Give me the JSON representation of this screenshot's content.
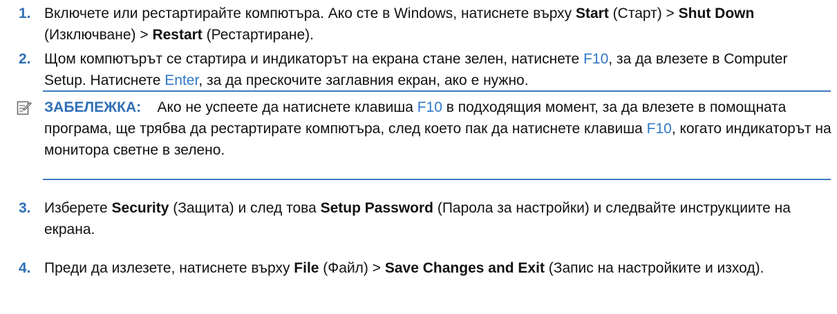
{
  "steps": [
    {
      "number": "1.",
      "parts": [
        "Включете или рестартирайте компютъра. Ако сте в Windows, натиснете върху ",
        "Start",
        " (Старт) > ",
        "Shut Down",
        " (Изключване) > ",
        "Restart",
        " (Рестартиране)."
      ]
    },
    {
      "number": "2.",
      "parts": [
        "Щом компютърът се стартира и индикаторът на екрана стане зелен, натиснете ",
        "F10",
        ", за да влезете в Computer Setup. Натиснете ",
        "Enter",
        ", за да прескочите заглавния екран, ако е нужно."
      ]
    },
    {
      "number": "3.",
      "parts": [
        "Изберете ",
        "Security",
        " (Защита) и след това ",
        "Setup Password",
        " (Парола за настройки) и следвайте инструкциите на екрана."
      ]
    },
    {
      "number": "4.",
      "parts": [
        "Преди да излезете, натиснете върху ",
        "File",
        " (Файл) > ",
        "Save Changes and Exit",
        " (Запис на настройките и изход)."
      ]
    }
  ],
  "note": {
    "icon": "note-pencil-icon",
    "label": "ЗАБЕЛЕЖКА:",
    "parts": [
      "Ако не успеете да натиснете клавиша ",
      "F10",
      " в подходящия момент, за да влезете в помощната програма, ще трябва да рестартирате компютъра, след което пак да натиснете клавиша ",
      "F10",
      ", когато индикаторът на монитора светне в зелено."
    ]
  },
  "colors": {
    "accent": "#2f6fb5",
    "key": "#2f78c8",
    "text": "#111111"
  }
}
